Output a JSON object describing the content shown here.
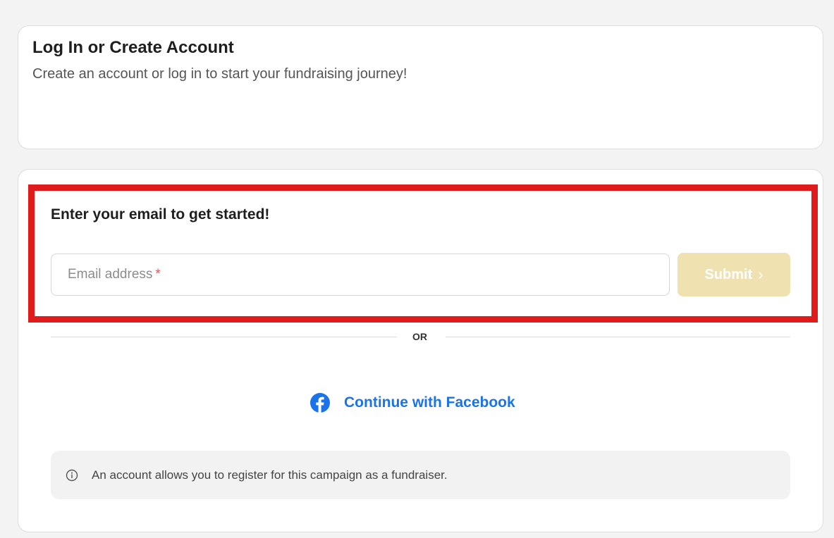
{
  "header": {
    "title": "Log In or Create Account",
    "subtitle": "Create an account or log in to start your fundraising journey!"
  },
  "email_section": {
    "heading": "Enter your email to get started!",
    "placeholder": "Email address",
    "required_marker": "*",
    "submit_label": "Submit",
    "submit_chevron": "›"
  },
  "divider": {
    "label": "OR"
  },
  "facebook": {
    "label": "Continue with Facebook",
    "icon": "facebook-icon"
  },
  "info": {
    "icon": "info-icon",
    "text": "An account allows you to register for this campaign as a fundraiser."
  },
  "colors": {
    "highlight": "#e01b1b",
    "submit_bg": "#f0e1b0",
    "facebook_blue": "#1a73e8"
  }
}
